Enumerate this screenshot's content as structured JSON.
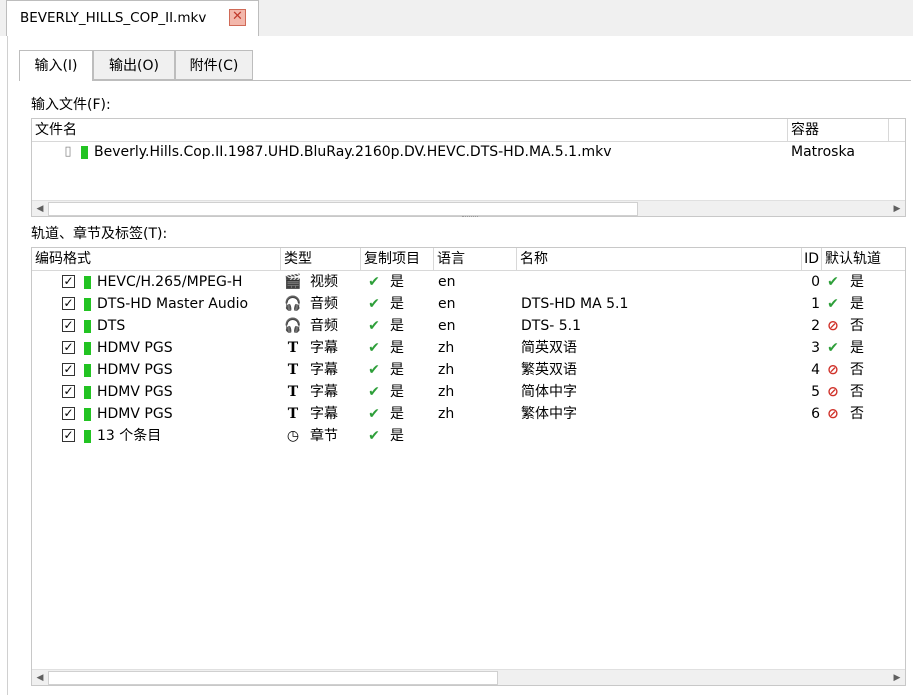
{
  "doc_tab": {
    "title": "BEVERLY_HILLS_COP_II.mkv",
    "close_icon": "close-icon"
  },
  "subtabs": [
    {
      "label": "输入(I)"
    },
    {
      "label": "输出(O)"
    },
    {
      "label": "附件(C)"
    }
  ],
  "input_files": {
    "label": "输入文件(F):",
    "columns": {
      "filename": "文件名",
      "container": "容器"
    },
    "rows": [
      {
        "filename": "Beverly.Hills.Cop.II.1987.UHD.BluRay.2160p.DV.HEVC.DTS-HD.MA.5.1.mkv",
        "container": "Matroska"
      }
    ]
  },
  "tracks": {
    "label": "轨道、章节及标签(T):",
    "columns": {
      "codec": "编码格式",
      "type": "类型",
      "copy": "复制项目",
      "language": "语言",
      "name": "名称",
      "id": "ID",
      "default": "默认轨道"
    },
    "rows": [
      {
        "codec": "HEVC/H.265/MPEG-H",
        "type_icon": "video-icon",
        "type": "视频",
        "copy": "是",
        "language": "en",
        "name": "",
        "id": "0",
        "default_icon": "check-icon",
        "default": "是"
      },
      {
        "codec": "DTS-HD Master Audio",
        "type_icon": "headphones-icon",
        "type": "音频",
        "copy": "是",
        "language": "en",
        "name": "DTS-HD MA 5.1",
        "id": "1",
        "default_icon": "check-icon",
        "default": "是"
      },
      {
        "codec": "DTS",
        "type_icon": "headphones-icon",
        "type": "音频",
        "copy": "是",
        "language": "en",
        "name": "DTS- 5.1",
        "id": "2",
        "default_icon": "no-icon",
        "default": "否"
      },
      {
        "codec": "HDMV PGS",
        "type_icon": "subtitle-icon",
        "type": "字幕",
        "copy": "是",
        "language": "zh",
        "name": "简英双语",
        "id": "3",
        "default_icon": "check-icon",
        "default": "是"
      },
      {
        "codec": "HDMV PGS",
        "type_icon": "subtitle-icon",
        "type": "字幕",
        "copy": "是",
        "language": "zh",
        "name": "繁英双语",
        "id": "4",
        "default_icon": "no-icon",
        "default": "否"
      },
      {
        "codec": "HDMV PGS",
        "type_icon": "subtitle-icon",
        "type": "字幕",
        "copy": "是",
        "language": "zh",
        "name": "简体中字",
        "id": "5",
        "default_icon": "no-icon",
        "default": "否"
      },
      {
        "codec": "HDMV PGS",
        "type_icon": "subtitle-icon",
        "type": "字幕",
        "copy": "是",
        "language": "zh",
        "name": "繁体中字",
        "id": "6",
        "default_icon": "no-icon",
        "default": "否"
      },
      {
        "codec": "13 个条目",
        "type_icon": "clock-icon",
        "type": "章节",
        "copy": "是",
        "language": "",
        "name": "",
        "id": "",
        "default_icon": "",
        "default": ""
      }
    ]
  },
  "colors": {
    "status_green": "#22c322",
    "check_green": "#2e9f3a",
    "no_red": "#d0322a",
    "close_bg": "#f3b7ab"
  }
}
